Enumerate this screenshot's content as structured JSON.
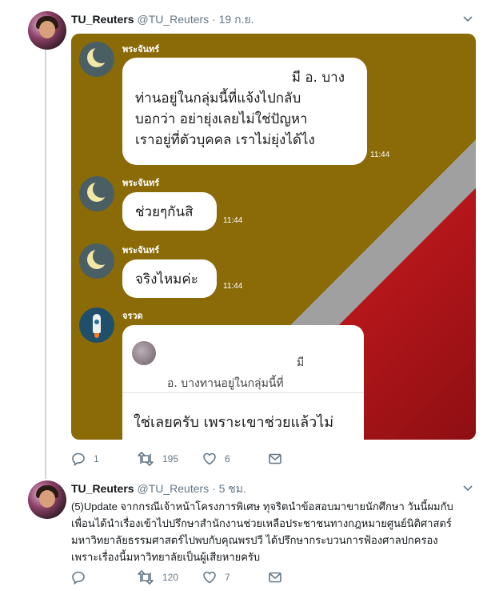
{
  "tweet1": {
    "name": "TU_Reuters",
    "handle": "@TU_Reuters",
    "separator": "·",
    "time": "19 ก.ย.",
    "actions": {
      "replies": "1",
      "retweets": "195",
      "likes": "6"
    },
    "media": {
      "messages": [
        {
          "sender": "พระจันทร์",
          "lines": [
            "มี อ. บาง",
            "ท่านอยู่ในกลุ่มนี้ที่แจ้งไปกลับ",
            "บอกว่า อย่ายุ่งเลยไม่ใช่ปัญหา",
            "เราอยู่ที่ตัวบุคคล เราไม่ยุ่งได้ไง"
          ],
          "time": "11:44"
        },
        {
          "sender": "พระจันทร์",
          "lines": [
            "ช่วยๆกันสิ"
          ],
          "time": "11:44"
        },
        {
          "sender": "พระจันทร์",
          "lines": [
            "จริงไหมค่ะ"
          ],
          "time": "11:44"
        }
      ],
      "reply": {
        "sender": "จรวด",
        "quoted_fragment": "มี",
        "quoted_line": "อ. บางทานอยู่ในกลุ่มนี้ที่",
        "text": "ใช่เลยครับ เพราะเขาช่วยแล้วไม่"
      },
      "colors": {
        "background": "#8a6b08",
        "accent_red": "#b5161b",
        "stripe": "#a0a0a0"
      }
    }
  },
  "tweet2": {
    "name": "TU_Reuters",
    "handle": "@TU_Reuters",
    "separator": "·",
    "time": "5 ชม.",
    "text_lines": [
      "(5)Update จากกรณีเจ้าหน้าโครงการพิเศษ ทุจริตนำข้อสอบมาขายนักศึกษา วันนี้ผมกับ",
      "เพื่อนได้นำเรื่องเข้าไปปรึกษาสำนักงานช่วยเหลือประชาชนทางกฎหมายศูนย์นิติศาสตร์",
      "มหาวิทยาลัยธรรมศาสตร์ไปพบกับคุณพรปวี ได้ปรึกษากระบวนการฟ้องศาลปกครอง",
      "เพราะเรื่องนี้มหาวิทยาลัยเป็นผู้เสียหายครับ"
    ],
    "actions": {
      "replies": "",
      "retweets": "120",
      "likes": "7"
    }
  },
  "icons": {
    "reply": "reply-icon",
    "retweet": "retweet-icon",
    "like": "heart-icon",
    "dm": "envelope-icon",
    "more": "chevron-down-icon"
  },
  "colors": {
    "text_primary": "#14171a",
    "text_secondary": "#657786",
    "thread_line": "#ccd6dd"
  }
}
